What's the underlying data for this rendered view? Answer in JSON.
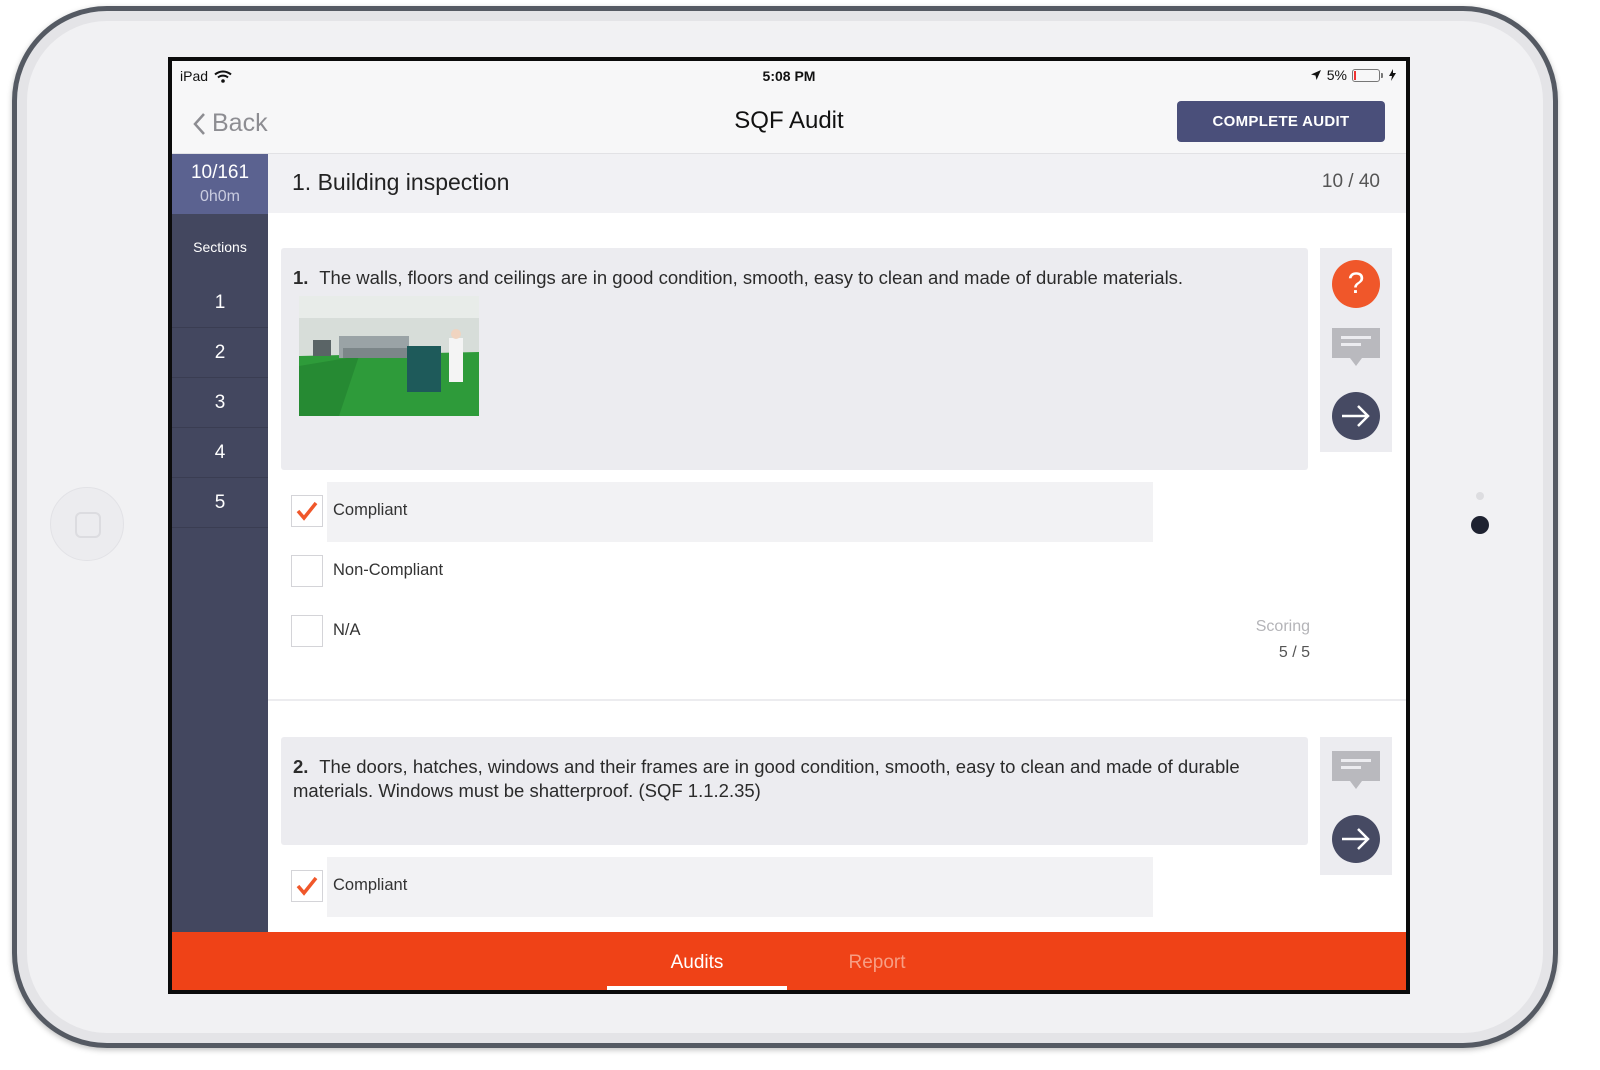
{
  "status_bar": {
    "device": "iPad",
    "time": "5:08 PM",
    "battery": "5%"
  },
  "nav": {
    "back_label": "Back",
    "title": "SQF Audit",
    "complete_button": "COMPLETE AUDIT"
  },
  "sidebar": {
    "progress": "10/161",
    "timer": "0h0m",
    "sections_label": "Sections",
    "sections": [
      "1",
      "2",
      "3",
      "4",
      "5"
    ]
  },
  "section": {
    "title": "1. Building inspection",
    "progress": "10 / 40"
  },
  "questions": [
    {
      "number": "1.",
      "text": "The walls, floors and ceilings are in good condition, smooth, easy to clean and made of durable materials.",
      "options": [
        {
          "label": "Compliant",
          "checked": true
        },
        {
          "label": "Non-Compliant",
          "checked": false
        },
        {
          "label": "N/A",
          "checked": false
        }
      ],
      "scoring_label": "Scoring",
      "scoring_value": "5 / 5"
    },
    {
      "number": "2.",
      "text": "The doors, hatches, windows and their frames are in good condition, smooth, easy to clean and made of durable materials. Windows must be shatterproof. (SQF 1.1.2.35)",
      "options": [
        {
          "label": "Compliant",
          "checked": true
        }
      ]
    }
  ],
  "tabs": {
    "audits": "Audits",
    "report": "Report",
    "active": "Audits"
  },
  "icons": {
    "help": "help-icon",
    "comment": "comment-icon",
    "next": "arrow-right-icon",
    "check": "checkmark-icon",
    "back": "chevron-left-icon",
    "wifi": "wifi-icon",
    "location": "location-arrow-icon"
  },
  "colors": {
    "accent_orange": "#ef4217",
    "sidebar": "#43475f",
    "primary_button": "#4a4f7a",
    "help_button": "#f0572a"
  }
}
